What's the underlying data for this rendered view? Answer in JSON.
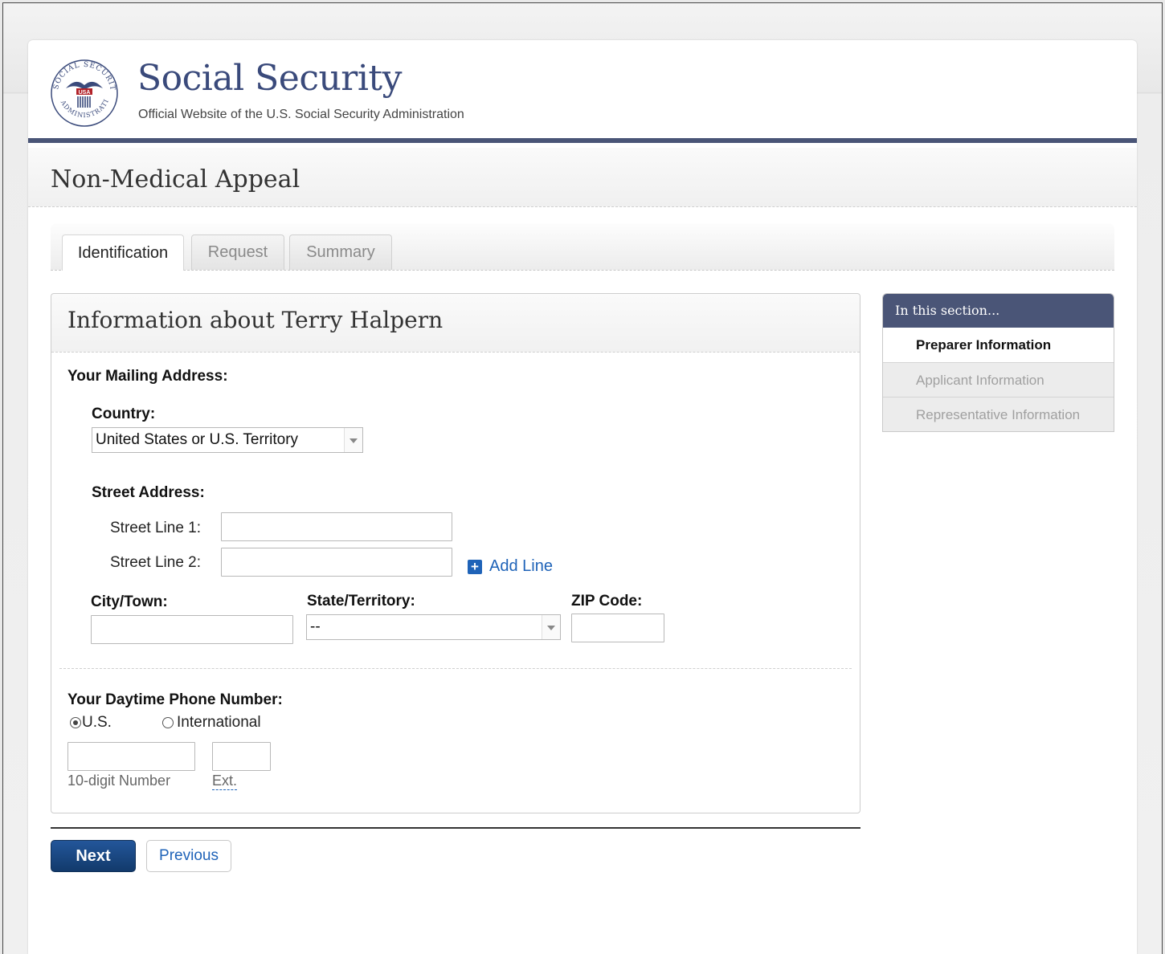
{
  "brand": {
    "title": "Social Security",
    "subtitle": "Official Website of the U.S. Social Security Administration",
    "seal_text": "SOCIAL SECURITY ADMINISTRATION",
    "seal_badge": "USA"
  },
  "page_title": "Non-Medical Appeal",
  "tabs": [
    {
      "label": "Identification",
      "active": true
    },
    {
      "label": "Request",
      "active": false
    },
    {
      "label": "Summary",
      "active": false
    }
  ],
  "panel": {
    "title": "Information about Terry Halpern",
    "mailing_address_label": "Your Mailing Address:",
    "country": {
      "label": "Country:",
      "value": "United States or U.S. Territory"
    },
    "street": {
      "label": "Street Address:",
      "line1_label": "Street Line 1:",
      "line1_value": "",
      "line2_label": "Street Line 2:",
      "line2_value": "",
      "add_line_label": "Add Line"
    },
    "city": {
      "label": "City/Town:",
      "value": ""
    },
    "state": {
      "label": "State/Territory:",
      "value": "--"
    },
    "zip": {
      "label": "ZIP Code:",
      "value": ""
    },
    "phone": {
      "label": "Your Daytime Phone Number:",
      "options": [
        {
          "label": "U.S.",
          "selected": true
        },
        {
          "label": "International",
          "selected": false
        }
      ],
      "number_hint": "10-digit Number",
      "ext_hint": "Ext.",
      "number_value": "",
      "ext_value": ""
    }
  },
  "buttons": {
    "next": "Next",
    "previous": "Previous"
  },
  "sidebar": {
    "heading": "In this section...",
    "items": [
      {
        "label": "Preparer Information",
        "active": true
      },
      {
        "label": "Applicant Information",
        "active": false
      },
      {
        "label": "Representative Information",
        "active": false
      }
    ]
  },
  "colors": {
    "brand_navy": "#4a5577",
    "link_blue": "#1f63b8",
    "button_navy": "#1a4a85"
  }
}
